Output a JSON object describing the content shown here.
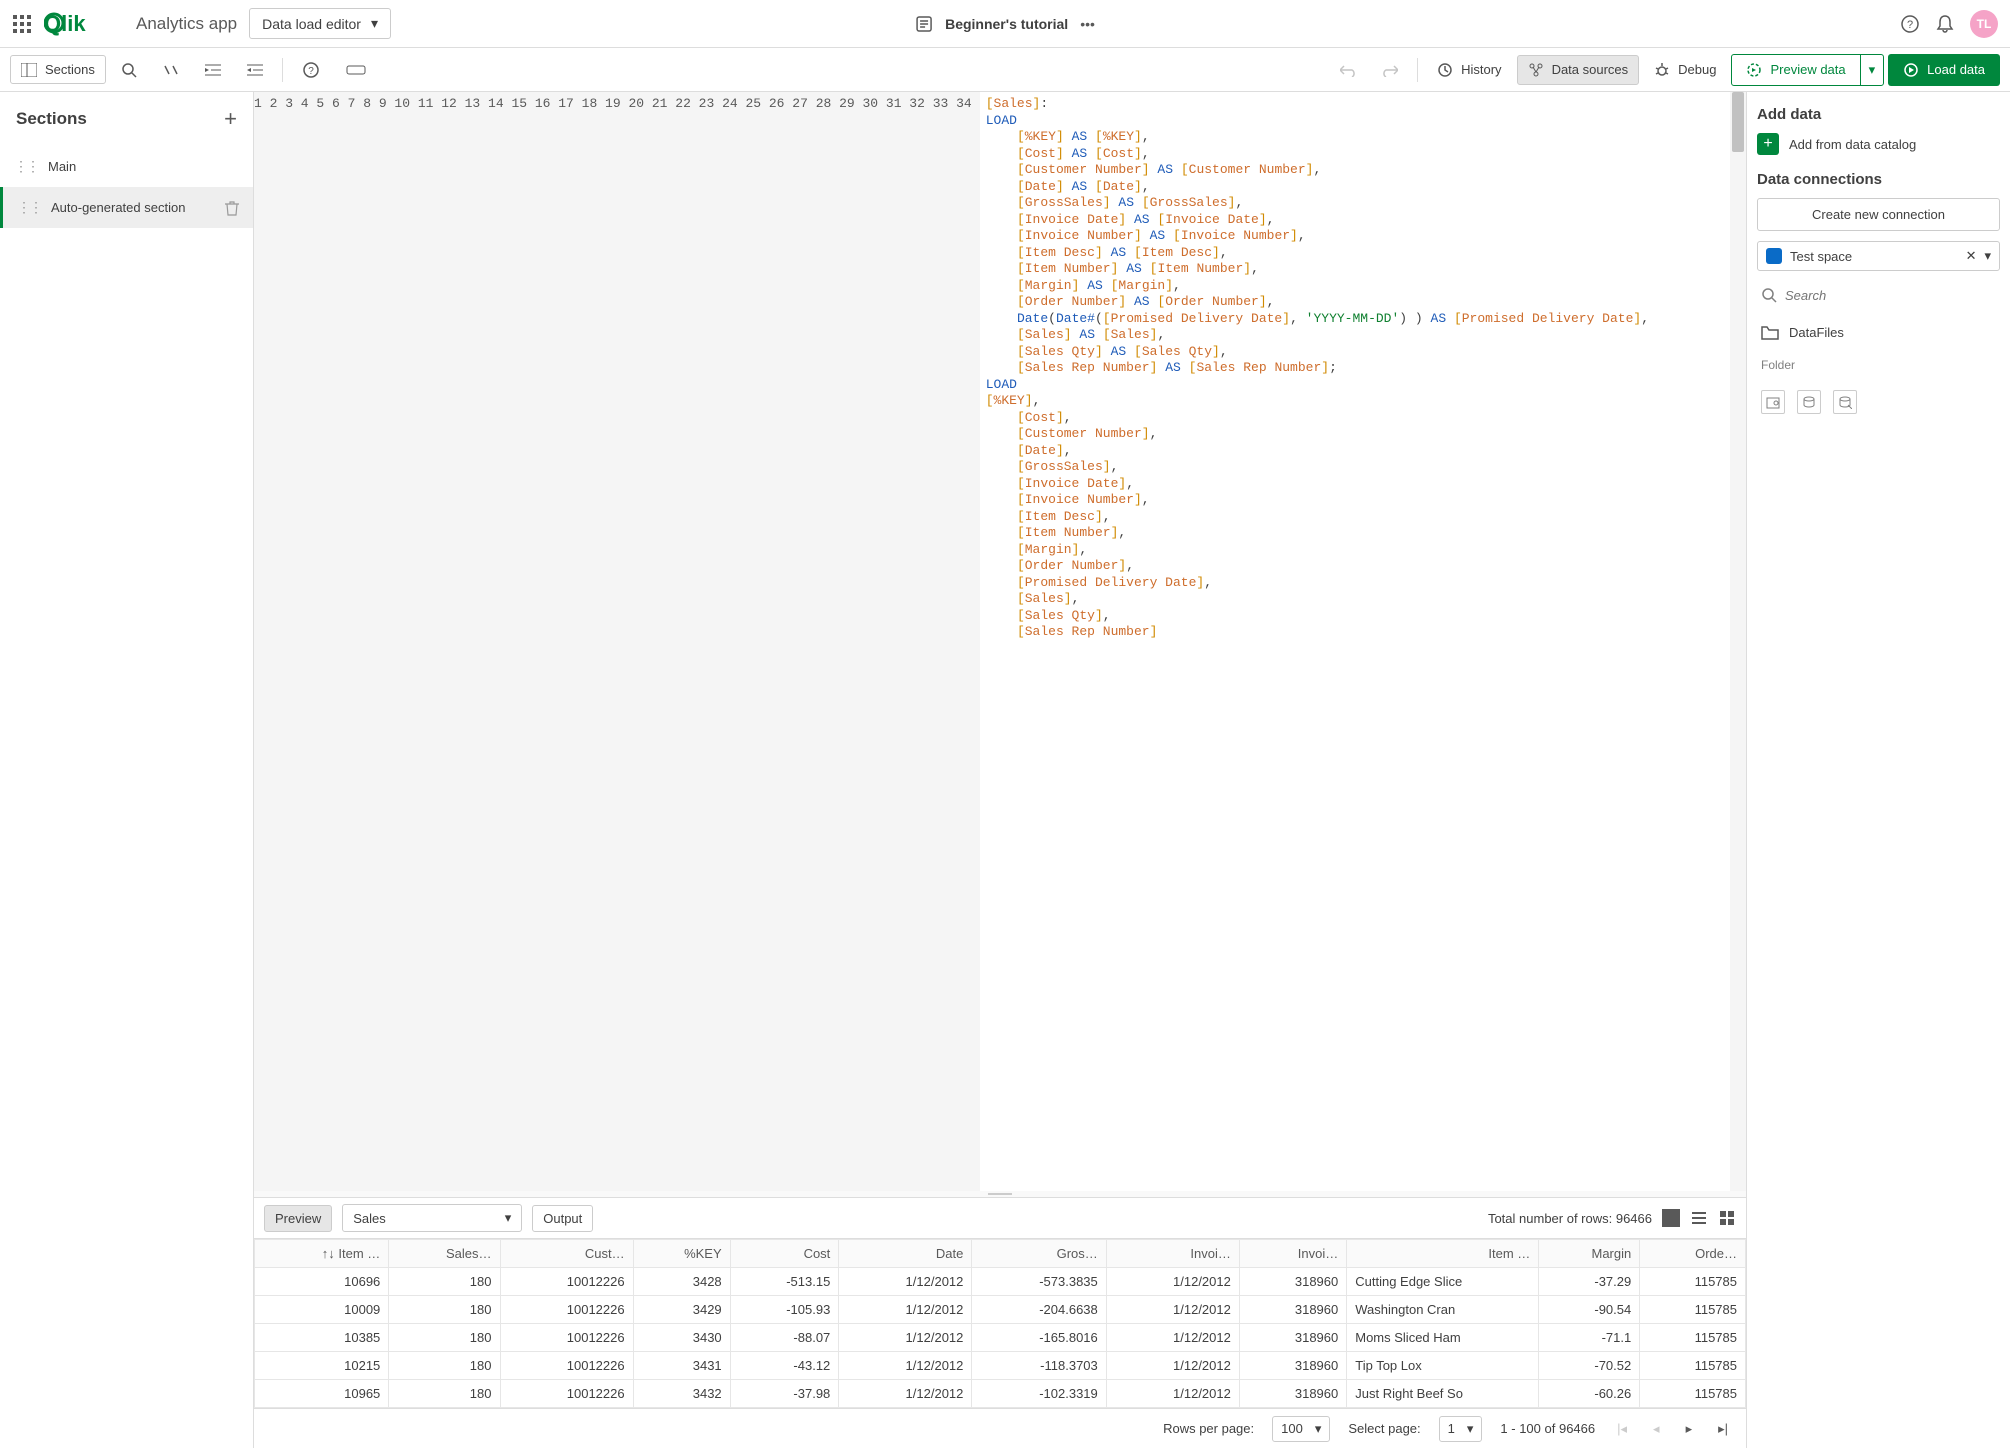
{
  "top": {
    "app_name": "Analytics app",
    "mode": "Data load editor",
    "doc_title": "Beginner's tutorial",
    "avatar": "TL"
  },
  "toolbar": {
    "sections": "Sections",
    "history": "History",
    "data_sources": "Data sources",
    "debug": "Debug",
    "preview": "Preview data",
    "load": "Load data"
  },
  "sidebar": {
    "title": "Sections",
    "items": [
      "Main",
      "Auto-generated section"
    ]
  },
  "right": {
    "add_data": "Add data",
    "add_catalog": "Add from data catalog",
    "data_connections": "Data connections",
    "create_conn": "Create new connection",
    "space": "Test space",
    "search_ph": "Search",
    "datafiles": "DataFiles",
    "folder": "Folder"
  },
  "code_lines": [
    {
      "n": 1,
      "seg": [
        [
          "br",
          "["
        ],
        [
          "fd",
          "Sales"
        ],
        [
          "br",
          "]"
        ],
        [
          "",
          ":"
        ]
      ]
    },
    {
      "n": 2,
      "seg": [
        [
          "kw",
          "LOAD"
        ]
      ]
    },
    {
      "n": 3,
      "seg": [
        [
          "",
          "    "
        ],
        [
          "br",
          "["
        ],
        [
          "fd",
          "%KEY"
        ],
        [
          "br",
          "]"
        ],
        [
          "",
          " "
        ],
        [
          "kw",
          "AS"
        ],
        [
          "",
          " "
        ],
        [
          "br",
          "["
        ],
        [
          "fd",
          "%KEY"
        ],
        [
          "br",
          "]"
        ],
        [
          "",
          ","
        ]
      ]
    },
    {
      "n": 4,
      "seg": [
        [
          "",
          "    "
        ],
        [
          "br",
          "["
        ],
        [
          "fd",
          "Cost"
        ],
        [
          "br",
          "]"
        ],
        [
          "",
          " "
        ],
        [
          "kw",
          "AS"
        ],
        [
          "",
          " "
        ],
        [
          "br",
          "["
        ],
        [
          "fd",
          "Cost"
        ],
        [
          "br",
          "]"
        ],
        [
          "",
          ","
        ]
      ]
    },
    {
      "n": 5,
      "seg": [
        [
          "",
          "    "
        ],
        [
          "br",
          "["
        ],
        [
          "fd",
          "Customer Number"
        ],
        [
          "br",
          "]"
        ],
        [
          "",
          " "
        ],
        [
          "kw",
          "AS"
        ],
        [
          "",
          " "
        ],
        [
          "br",
          "["
        ],
        [
          "fd",
          "Customer Number"
        ],
        [
          "br",
          "]"
        ],
        [
          "",
          ","
        ]
      ]
    },
    {
      "n": 6,
      "seg": [
        [
          "",
          "    "
        ],
        [
          "br",
          "["
        ],
        [
          "fd",
          "Date"
        ],
        [
          "br",
          "]"
        ],
        [
          "",
          " "
        ],
        [
          "kw",
          "AS"
        ],
        [
          "",
          " "
        ],
        [
          "br",
          "["
        ],
        [
          "fd",
          "Date"
        ],
        [
          "br",
          "]"
        ],
        [
          "",
          ","
        ]
      ]
    },
    {
      "n": 7,
      "seg": [
        [
          "",
          "    "
        ],
        [
          "br",
          "["
        ],
        [
          "fd",
          "GrossSales"
        ],
        [
          "br",
          "]"
        ],
        [
          "",
          " "
        ],
        [
          "kw",
          "AS"
        ],
        [
          "",
          " "
        ],
        [
          "br",
          "["
        ],
        [
          "fd",
          "GrossSales"
        ],
        [
          "br",
          "]"
        ],
        [
          "",
          ","
        ]
      ]
    },
    {
      "n": 8,
      "seg": [
        [
          "",
          "    "
        ],
        [
          "br",
          "["
        ],
        [
          "fd",
          "Invoice Date"
        ],
        [
          "br",
          "]"
        ],
        [
          "",
          " "
        ],
        [
          "kw",
          "AS"
        ],
        [
          "",
          " "
        ],
        [
          "br",
          "["
        ],
        [
          "fd",
          "Invoice Date"
        ],
        [
          "br",
          "]"
        ],
        [
          "",
          ","
        ]
      ]
    },
    {
      "n": 9,
      "seg": [
        [
          "",
          "    "
        ],
        [
          "br",
          "["
        ],
        [
          "fd",
          "Invoice Number"
        ],
        [
          "br",
          "]"
        ],
        [
          "",
          " "
        ],
        [
          "kw",
          "AS"
        ],
        [
          "",
          " "
        ],
        [
          "br",
          "["
        ],
        [
          "fd",
          "Invoice Number"
        ],
        [
          "br",
          "]"
        ],
        [
          "",
          ","
        ]
      ]
    },
    {
      "n": 10,
      "seg": [
        [
          "",
          "    "
        ],
        [
          "br",
          "["
        ],
        [
          "fd",
          "Item Desc"
        ],
        [
          "br",
          "]"
        ],
        [
          "",
          " "
        ],
        [
          "kw",
          "AS"
        ],
        [
          "",
          " "
        ],
        [
          "br",
          "["
        ],
        [
          "fd",
          "Item Desc"
        ],
        [
          "br",
          "]"
        ],
        [
          "",
          ","
        ]
      ]
    },
    {
      "n": 11,
      "seg": [
        [
          "",
          "    "
        ],
        [
          "br",
          "["
        ],
        [
          "fd",
          "Item Number"
        ],
        [
          "br",
          "]"
        ],
        [
          "",
          " "
        ],
        [
          "kw",
          "AS"
        ],
        [
          "",
          " "
        ],
        [
          "br",
          "["
        ],
        [
          "fd",
          "Item Number"
        ],
        [
          "br",
          "]"
        ],
        [
          "",
          ","
        ]
      ]
    },
    {
      "n": 12,
      "seg": [
        [
          "",
          "    "
        ],
        [
          "br",
          "["
        ],
        [
          "fd",
          "Margin"
        ],
        [
          "br",
          "]"
        ],
        [
          "",
          " "
        ],
        [
          "kw",
          "AS"
        ],
        [
          "",
          " "
        ],
        [
          "br",
          "["
        ],
        [
          "fd",
          "Margin"
        ],
        [
          "br",
          "]"
        ],
        [
          "",
          ","
        ]
      ]
    },
    {
      "n": 13,
      "seg": [
        [
          "",
          "    "
        ],
        [
          "br",
          "["
        ],
        [
          "fd",
          "Order Number"
        ],
        [
          "br",
          "]"
        ],
        [
          "",
          " "
        ],
        [
          "kw",
          "AS"
        ],
        [
          "",
          " "
        ],
        [
          "br",
          "["
        ],
        [
          "fd",
          "Order Number"
        ],
        [
          "br",
          "]"
        ],
        [
          "",
          ","
        ]
      ]
    },
    {
      "n": 14,
      "seg": [
        [
          "",
          "    "
        ],
        [
          "fn",
          "Date"
        ],
        [
          "",
          "("
        ],
        [
          "fn",
          "Date#"
        ],
        [
          "",
          "("
        ],
        [
          "br",
          "["
        ],
        [
          "fd",
          "Promised Delivery Date"
        ],
        [
          "br",
          "]"
        ],
        [
          "",
          ", "
        ],
        [
          "str",
          "'YYYY-MM-DD'"
        ],
        [
          "",
          ") ) "
        ],
        [
          "kw",
          "AS"
        ],
        [
          "",
          " "
        ],
        [
          "br",
          "["
        ],
        [
          "fd",
          "Promised Delivery Date"
        ],
        [
          "br",
          "]"
        ],
        [
          "",
          ","
        ]
      ]
    },
    {
      "n": 15,
      "seg": [
        [
          "",
          "    "
        ],
        [
          "br",
          "["
        ],
        [
          "fd",
          "Sales"
        ],
        [
          "br",
          "]"
        ],
        [
          "",
          " "
        ],
        [
          "kw",
          "AS"
        ],
        [
          "",
          " "
        ],
        [
          "br",
          "["
        ],
        [
          "fd",
          "Sales"
        ],
        [
          "br",
          "]"
        ],
        [
          "",
          ","
        ]
      ]
    },
    {
      "n": 16,
      "seg": [
        [
          "",
          "    "
        ],
        [
          "br",
          "["
        ],
        [
          "fd",
          "Sales Qty"
        ],
        [
          "br",
          "]"
        ],
        [
          "",
          " "
        ],
        [
          "kw",
          "AS"
        ],
        [
          "",
          " "
        ],
        [
          "br",
          "["
        ],
        [
          "fd",
          "Sales Qty"
        ],
        [
          "br",
          "]"
        ],
        [
          "",
          ","
        ]
      ]
    },
    {
      "n": 17,
      "seg": [
        [
          "",
          "    "
        ],
        [
          "br",
          "["
        ],
        [
          "fd",
          "Sales Rep Number"
        ],
        [
          "br",
          "]"
        ],
        [
          "",
          " "
        ],
        [
          "kw",
          "AS"
        ],
        [
          "",
          " "
        ],
        [
          "br",
          "["
        ],
        [
          "fd",
          "Sales Rep Number"
        ],
        [
          "br",
          "]"
        ],
        [
          "",
          ";"
        ]
      ]
    },
    {
      "n": 18,
      "seg": [
        [
          "kw",
          "LOAD"
        ]
      ]
    },
    {
      "n": 19,
      "seg": [
        [
          "br",
          "["
        ],
        [
          "fd",
          "%KEY"
        ],
        [
          "br",
          "]"
        ],
        [
          "",
          ","
        ]
      ]
    },
    {
      "n": 20,
      "seg": [
        [
          "",
          "    "
        ],
        [
          "br",
          "["
        ],
        [
          "fd",
          "Cost"
        ],
        [
          "br",
          "]"
        ],
        [
          "",
          ","
        ]
      ]
    },
    {
      "n": 21,
      "seg": [
        [
          "",
          "    "
        ],
        [
          "br",
          "["
        ],
        [
          "fd",
          "Customer Number"
        ],
        [
          "br",
          "]"
        ],
        [
          "",
          ","
        ]
      ]
    },
    {
      "n": 22,
      "seg": [
        [
          "",
          "    "
        ],
        [
          "br",
          "["
        ],
        [
          "fd",
          "Date"
        ],
        [
          "br",
          "]"
        ],
        [
          "",
          ","
        ]
      ]
    },
    {
      "n": 23,
      "seg": [
        [
          "",
          "    "
        ],
        [
          "br",
          "["
        ],
        [
          "fd",
          "GrossSales"
        ],
        [
          "br",
          "]"
        ],
        [
          "",
          ","
        ]
      ]
    },
    {
      "n": 24,
      "seg": [
        [
          "",
          "    "
        ],
        [
          "br",
          "["
        ],
        [
          "fd",
          "Invoice Date"
        ],
        [
          "br",
          "]"
        ],
        [
          "",
          ","
        ]
      ]
    },
    {
      "n": 25,
      "seg": [
        [
          "",
          "    "
        ],
        [
          "br",
          "["
        ],
        [
          "fd",
          "Invoice Number"
        ],
        [
          "br",
          "]"
        ],
        [
          "",
          ","
        ]
      ]
    },
    {
      "n": 26,
      "seg": [
        [
          "",
          "    "
        ],
        [
          "br",
          "["
        ],
        [
          "fd",
          "Item Desc"
        ],
        [
          "br",
          "]"
        ],
        [
          "",
          ","
        ]
      ]
    },
    {
      "n": 27,
      "seg": [
        [
          "",
          "    "
        ],
        [
          "br",
          "["
        ],
        [
          "fd",
          "Item Number"
        ],
        [
          "br",
          "]"
        ],
        [
          "",
          ","
        ]
      ]
    },
    {
      "n": 28,
      "seg": [
        [
          "",
          "    "
        ],
        [
          "br",
          "["
        ],
        [
          "fd",
          "Margin"
        ],
        [
          "br",
          "]"
        ],
        [
          "",
          ","
        ]
      ]
    },
    {
      "n": 29,
      "seg": [
        [
          "",
          "    "
        ],
        [
          "br",
          "["
        ],
        [
          "fd",
          "Order Number"
        ],
        [
          "br",
          "]"
        ],
        [
          "",
          ","
        ]
      ]
    },
    {
      "n": 30,
      "seg": [
        [
          "",
          "    "
        ],
        [
          "br",
          "["
        ],
        [
          "fd",
          "Promised Delivery Date"
        ],
        [
          "br",
          "]"
        ],
        [
          "",
          ","
        ]
      ]
    },
    {
      "n": 31,
      "seg": [
        [
          "",
          "    "
        ],
        [
          "br",
          "["
        ],
        [
          "fd",
          "Sales"
        ],
        [
          "br",
          "]"
        ],
        [
          "",
          ","
        ]
      ]
    },
    {
      "n": 32,
      "seg": [
        [
          "",
          "    "
        ],
        [
          "br",
          "["
        ],
        [
          "fd",
          "Sales Qty"
        ],
        [
          "br",
          "]"
        ],
        [
          "",
          ","
        ]
      ]
    },
    {
      "n": 33,
      "seg": [
        [
          "",
          "    "
        ],
        [
          "br",
          "["
        ],
        [
          "fd",
          "Sales Rep Number"
        ],
        [
          "br",
          "]"
        ]
      ]
    },
    {
      "n": 34,
      "seg": [
        [
          "",
          ""
        ]
      ]
    }
  ],
  "bottom": {
    "preview": "Preview",
    "output": "Output",
    "table_sel": "Sales",
    "total_rows": "Total number of rows: 96466",
    "headers": [
      "Item …",
      "Sales…",
      "Cust…",
      "%KEY",
      "Cost",
      "Date",
      "Gros…",
      "Invoi…",
      "Invoi…",
      "Item …",
      "Margin",
      "Orde…"
    ],
    "rows": [
      [
        "10696",
        "180",
        "10012226",
        "3428",
        "-513.15",
        "1/12/2012",
        "-573.3835",
        "1/12/2012",
        "318960",
        "Cutting Edge Slice",
        "-37.29",
        "115785"
      ],
      [
        "10009",
        "180",
        "10012226",
        "3429",
        "-105.93",
        "1/12/2012",
        "-204.6638",
        "1/12/2012",
        "318960",
        "Washington Cran",
        "-90.54",
        "115785"
      ],
      [
        "10385",
        "180",
        "10012226",
        "3430",
        "-88.07",
        "1/12/2012",
        "-165.8016",
        "1/12/2012",
        "318960",
        "Moms Sliced Ham",
        "-71.1",
        "115785"
      ],
      [
        "10215",
        "180",
        "10012226",
        "3431",
        "-43.12",
        "1/12/2012",
        "-118.3703",
        "1/12/2012",
        "318960",
        "Tip Top Lox",
        "-70.52",
        "115785"
      ],
      [
        "10965",
        "180",
        "10012226",
        "3432",
        "-37.98",
        "1/12/2012",
        "-102.3319",
        "1/12/2012",
        "318960",
        "Just Right Beef So",
        "-60.26",
        "115785"
      ]
    ],
    "rows_per_page": "Rows per page:",
    "rpp_val": "100",
    "select_page": "Select page:",
    "sp_val": "1",
    "range": "1 - 100 of 96466"
  }
}
